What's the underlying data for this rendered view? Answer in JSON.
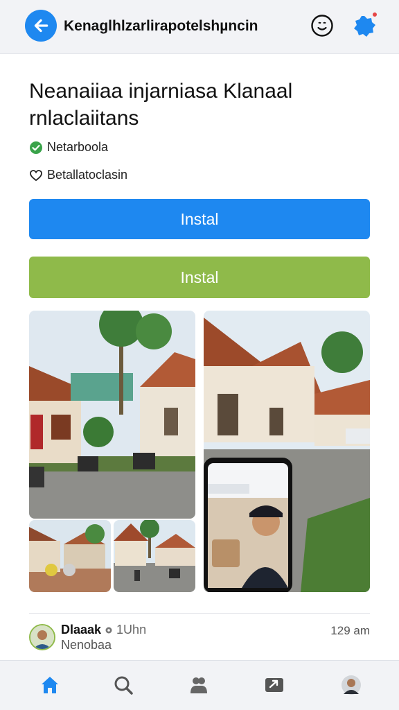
{
  "header": {
    "title": "Kenaglhlzarlirapotelshµncin",
    "icons": {
      "back": "back-arrow-icon",
      "smile": "smile-icon",
      "badge": "verified-badge-icon"
    },
    "accent": "#1e88f0"
  },
  "app": {
    "title": "Neanaiiaa injarniasa Klanaal rnlaclaiitans",
    "meta_verified": "Netarboola",
    "meta_favorite": "Betallatoclasin"
  },
  "buttons": {
    "install_primary": "Instal",
    "install_secondary": "Instal",
    "primary_color": "#1e88f0",
    "secondary_color": "#8fba4a"
  },
  "post": {
    "name": "Dlaaak",
    "ago": "1Uhn",
    "subtitle": "Nenobaa",
    "time": "129 am"
  },
  "bottom_nav": {
    "items": [
      "home-icon",
      "search-icon",
      "community-icon",
      "share-icon",
      "profile-avatar"
    ]
  }
}
